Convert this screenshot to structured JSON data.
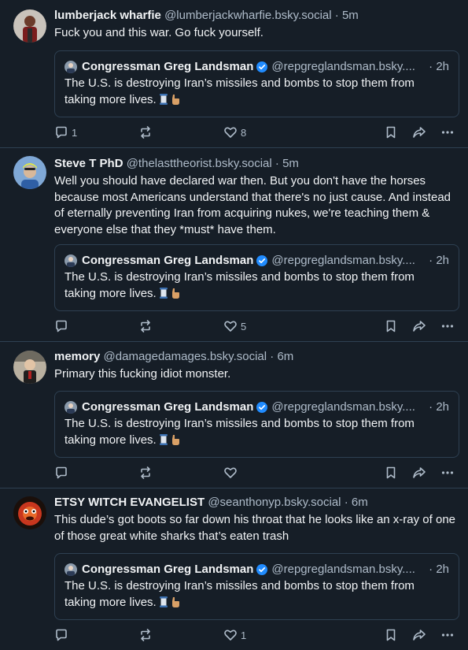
{
  "posts": [
    {
      "author": "lumberjack wharfie",
      "handle": "@lumberjackwharfie.bsky.social",
      "time": "5m",
      "text": "Fuck you and this war. Go fuck yourself.",
      "quote": {
        "author": "Congressman Greg Landsman",
        "handle": "@repgreglandsman.bsky....",
        "time": "2h",
        "text": "The U.S. is destroying Iran’s missiles and bombs to stop them from taking more lives."
      },
      "replies": "1",
      "reposts": "",
      "likes": "8"
    },
    {
      "author": "Steve T PhD",
      "handle": "@thelasttheorist.bsky.social",
      "time": "5m",
      "text": "Well you should have declared war then. But you don't have the horses because most Americans understand that there's no just cause. And instead of eternally preventing Iran from acquiring nukes, we're teaching them & everyone else that they *must* have them.",
      "quote": {
        "author": "Congressman Greg Landsman",
        "handle": "@repgreglandsman.bsky....",
        "time": "2h",
        "text": "The U.S. is destroying Iran’s missiles and bombs to stop them from taking more lives."
      },
      "replies": "",
      "reposts": "",
      "likes": "5"
    },
    {
      "author": "memory",
      "handle": "@damagedamages.bsky.social",
      "time": "6m",
      "text": "Primary this fucking idiot monster.",
      "quote": {
        "author": "Congressman Greg Landsman",
        "handle": "@repgreglandsman.bsky....",
        "time": "2h",
        "text": "The U.S. is destroying Iran’s missiles and bombs to stop them from taking more lives."
      },
      "replies": "",
      "reposts": "",
      "likes": ""
    },
    {
      "author": "ETSY WITCH EVANGELIST",
      "handle": "@seanthonyp.bsky.social",
      "time": "6m",
      "text": "This dude’s got boots so far down his throat that he looks like an x-ray of one of those great white sharks that’s eaten trash",
      "quote": {
        "author": "Congressman Greg Landsman",
        "handle": "@repgreglandsman.bsky....",
        "time": "2h",
        "text": "The U.S. is destroying Iran’s missiles and bombs to stop them from taking more lives."
      },
      "replies": "",
      "reposts": "",
      "likes": "1"
    }
  ],
  "separator": "·",
  "colors": {
    "background": "#161e27",
    "border": "#2e4052",
    "muted": "#aebbc9",
    "verified": "#208bfe"
  },
  "icons": [
    "reply-icon",
    "repost-icon",
    "like-icon",
    "bookmark-icon",
    "share-icon",
    "more-icon",
    "verified-badge-icon",
    "thread-emoji-icon",
    "hand-emoji-icon"
  ]
}
